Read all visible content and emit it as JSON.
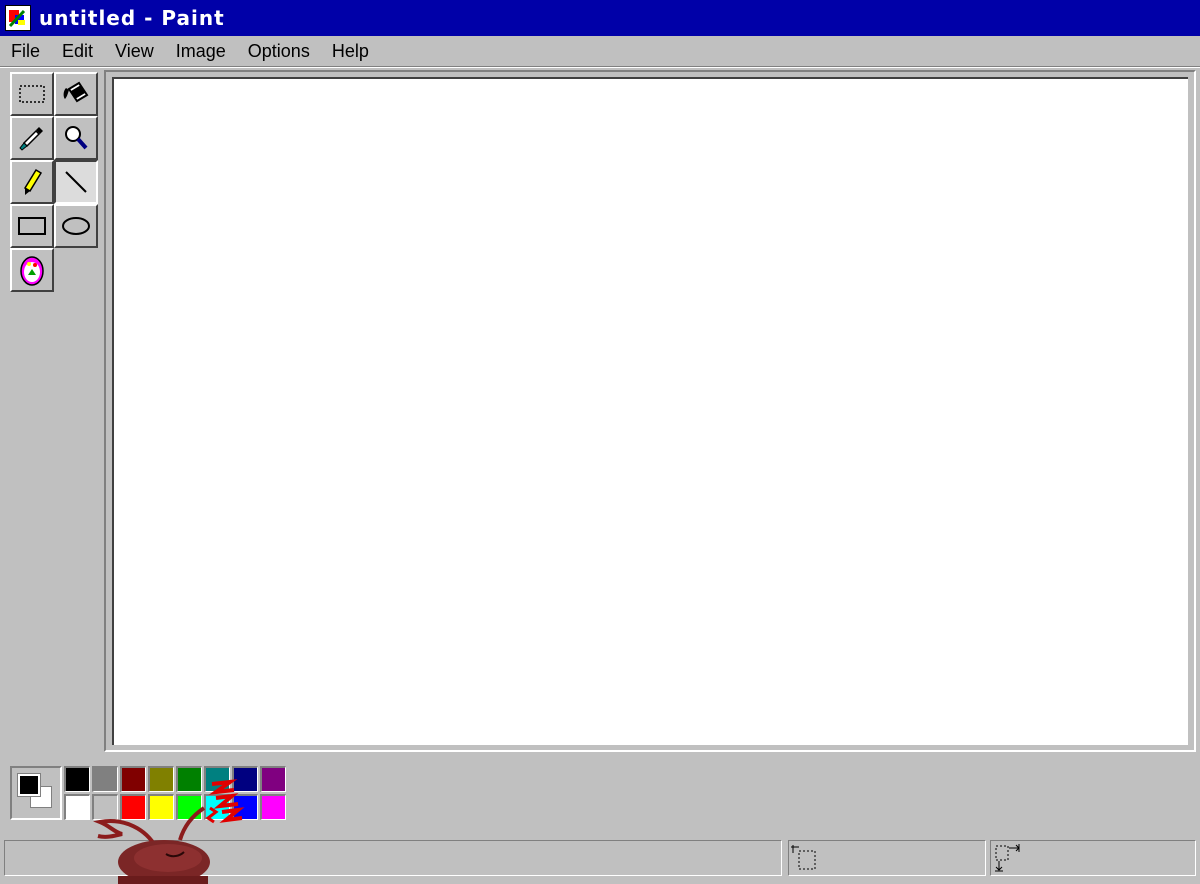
{
  "window": {
    "title": "untitled - Paint"
  },
  "menu": [
    "File",
    "Edit",
    "View",
    "Image",
    "Options",
    "Help"
  ],
  "toolbox": {
    "tools": [
      {
        "name": "select",
        "icon": "select-icon"
      },
      {
        "name": "fill",
        "icon": "fill-bucket-icon"
      },
      {
        "name": "pick-color",
        "icon": "eyedropper-icon"
      },
      {
        "name": "magnifier",
        "icon": "magnifier-icon"
      },
      {
        "name": "pencil",
        "icon": "pencil-icon"
      },
      {
        "name": "line",
        "icon": "line-icon",
        "selected": true
      },
      {
        "name": "rectangle",
        "icon": "rectangle-icon"
      },
      {
        "name": "ellipse",
        "icon": "ellipse-icon"
      },
      {
        "name": "stamp",
        "icon": "stamp-icon"
      }
    ]
  },
  "colors": {
    "foreground": "#000000",
    "background": "#ffffff",
    "palette_top": [
      "#000000",
      "#808080",
      "#800000",
      "#808000",
      "#008000",
      "#008080",
      "#000080",
      "#800080"
    ],
    "palette_bottom": [
      "#ffffff",
      "#c0c0c0",
      "#ff0000",
      "#ffff00",
      "#00ff00",
      "#00ffff",
      "#0000ff",
      "#ff00ff"
    ]
  },
  "statusbar": {
    "message": "",
    "position": "",
    "size": ""
  }
}
